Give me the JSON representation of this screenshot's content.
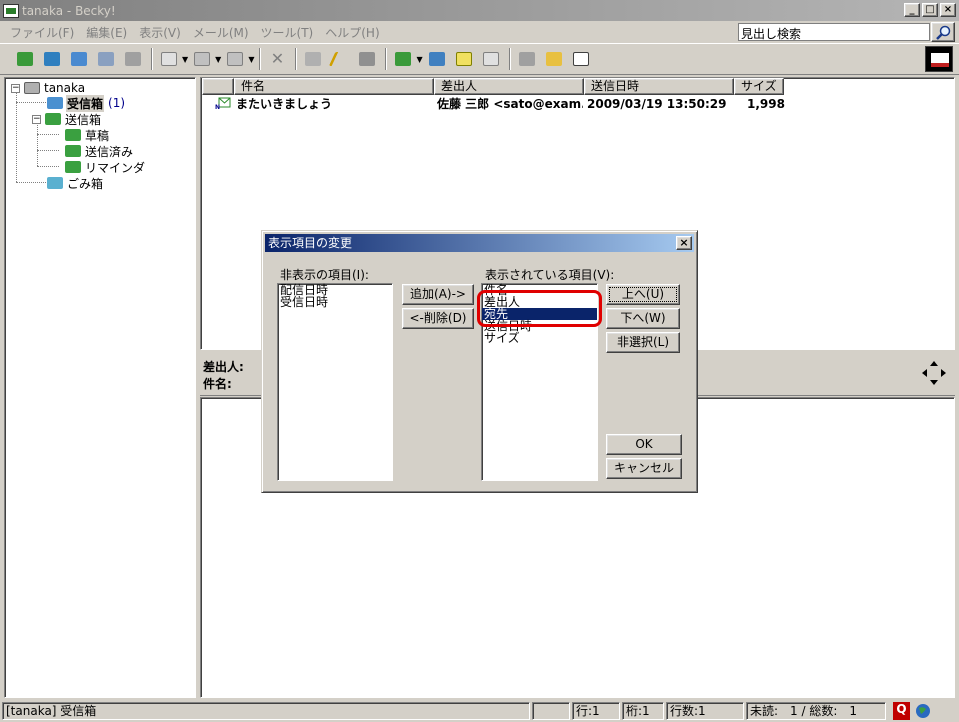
{
  "window": {
    "title": "tanaka - Becky!"
  },
  "menu": [
    {
      "label": "ファイル(F)"
    },
    {
      "label": "編集(E)"
    },
    {
      "label": "表示(V)"
    },
    {
      "label": "メール(M)"
    },
    {
      "label": "ツール(T)"
    },
    {
      "label": "ヘルプ(H)"
    }
  ],
  "search": {
    "value": "見出し検索"
  },
  "folders": {
    "root": "tanaka",
    "inbox": "受信箱",
    "inbox_count": "(1)",
    "outbox": "送信箱",
    "drafts": "草稿",
    "sent": "送信済み",
    "reminders": "リマインダ",
    "trash": "ごみ箱"
  },
  "list": {
    "columns": {
      "subject": "件名",
      "from": "差出人",
      "date": "送信日時",
      "size": "サイズ"
    },
    "messages": [
      {
        "subject": "またいきましょう",
        "from": "佐藤 三郎 <sato@exam...",
        "date": "2009/03/19 13:50:29",
        "size": "1,998"
      }
    ]
  },
  "preview": {
    "from_label": "差出人:",
    "subject_label": "件名:"
  },
  "status": {
    "folder": "[tanaka] 受信箱",
    "line": "行:1",
    "col": "桁:1",
    "lines": "行数:1",
    "unread": "未読:",
    "counts": "1 / 総数:",
    "total": "1"
  },
  "dialog": {
    "title": "表示項目の変更",
    "hidden_label": "非表示の項目(I):",
    "hidden_items": [
      "配信日時",
      "受信日時"
    ],
    "shown_label": "表示されている項目(V):",
    "shown_items": [
      "件名",
      "差出人",
      "宛先",
      "送信日時",
      "サイズ"
    ],
    "selected_index": 2,
    "add_button": "追加(A)->",
    "remove_button": "<-削除(D)",
    "up_button": "上へ(U)",
    "down_button": "下へ(W)",
    "deselect_button": "非選択(L)",
    "ok_button": "OK",
    "cancel_button": "キャンセル"
  },
  "colors": {
    "selection": "#0a246a",
    "highlight_mark": "#e00000",
    "inbox_count": "#00008b"
  }
}
